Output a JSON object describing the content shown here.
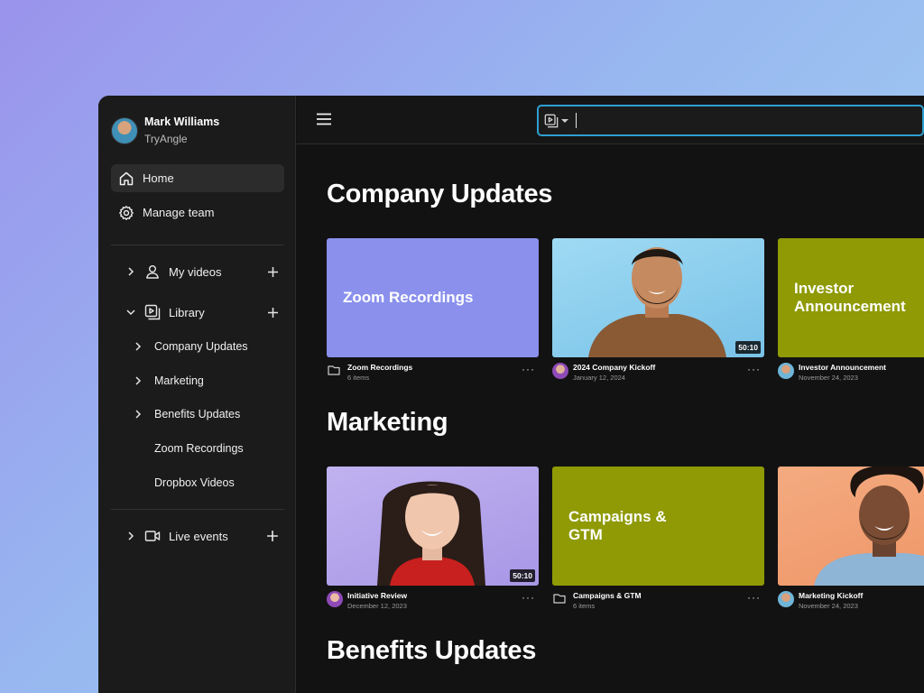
{
  "profile": {
    "name": "Mark Williams",
    "org": "TryAngle",
    "avatar_icon": "user-avatar"
  },
  "nav": {
    "home": {
      "label": "Home",
      "icon": "home-icon"
    },
    "manage_team": {
      "label": "Manage team",
      "icon": "gear-icon"
    }
  },
  "tree": {
    "my_videos": {
      "label": "My videos",
      "expanded": false
    },
    "library": {
      "label": "Library",
      "expanded": true,
      "children": [
        {
          "label": "Company Updates",
          "has_children": true
        },
        {
          "label": "Marketing",
          "has_children": true
        },
        {
          "label": "Benefits Updates",
          "has_children": true
        },
        {
          "label": "Zoom Recordings",
          "has_children": false
        },
        {
          "label": "Dropbox Videos",
          "has_children": false
        }
      ]
    },
    "live_events": {
      "label": "Live events",
      "expanded": false
    }
  },
  "search": {
    "value": "",
    "placeholder": "",
    "type_icon": "video-library-icon"
  },
  "sections": [
    {
      "title": "Company Updates",
      "cards": [
        {
          "kind": "folder",
          "thumb_text": "Zoom Recordings",
          "title": "Zoom Recordings",
          "subtitle": "6 items",
          "color": "#8a90ec"
        },
        {
          "kind": "video",
          "title": "2024 Company Kickoff",
          "subtitle": "January 12, 2024",
          "duration": "50:10",
          "color": "#8fd0ee"
        },
        {
          "kind": "video",
          "thumb_text": "Investor Announcement",
          "title": "Investor Announcement",
          "subtitle": "November 24, 2023",
          "color": "#8f9a05"
        }
      ]
    },
    {
      "title": "Marketing",
      "cards": [
        {
          "kind": "video",
          "title": "Initiative Review",
          "subtitle": "December 12, 2023",
          "duration": "50:10",
          "color": "#b7a5ec"
        },
        {
          "kind": "folder",
          "thumb_text": "Campaigns & GTM",
          "title": "Campaigns & GTM",
          "subtitle": "6 items",
          "color": "#8f9a05"
        },
        {
          "kind": "video",
          "title": "Marketing Kickoff",
          "subtitle": "November 24, 2023",
          "color": "#f0a276"
        }
      ]
    },
    {
      "title": "Benefits Updates",
      "cards": []
    }
  ],
  "more_label": "···",
  "colors": {
    "accent": "#2e9fd1",
    "bg": "#121212",
    "sidebar": "#1b1b1b"
  }
}
